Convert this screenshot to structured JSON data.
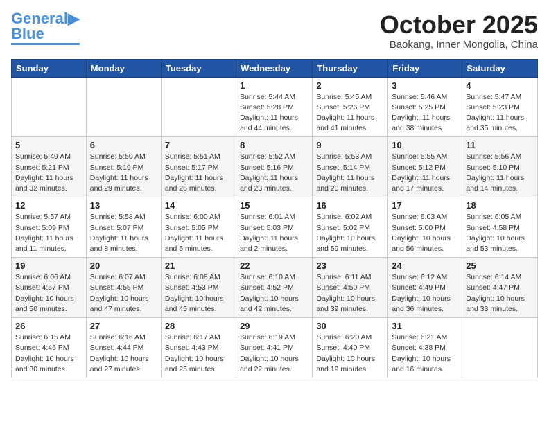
{
  "header": {
    "logo_line1": "General",
    "logo_line2": "Blue",
    "month": "October 2025",
    "location": "Baokang, Inner Mongolia, China"
  },
  "weekdays": [
    "Sunday",
    "Monday",
    "Tuesday",
    "Wednesday",
    "Thursday",
    "Friday",
    "Saturday"
  ],
  "weeks": [
    [
      {
        "day": "",
        "info": ""
      },
      {
        "day": "",
        "info": ""
      },
      {
        "day": "",
        "info": ""
      },
      {
        "day": "1",
        "info": "Sunrise: 5:44 AM\nSunset: 5:28 PM\nDaylight: 11 hours and 44 minutes."
      },
      {
        "day": "2",
        "info": "Sunrise: 5:45 AM\nSunset: 5:26 PM\nDaylight: 11 hours and 41 minutes."
      },
      {
        "day": "3",
        "info": "Sunrise: 5:46 AM\nSunset: 5:25 PM\nDaylight: 11 hours and 38 minutes."
      },
      {
        "day": "4",
        "info": "Sunrise: 5:47 AM\nSunset: 5:23 PM\nDaylight: 11 hours and 35 minutes."
      }
    ],
    [
      {
        "day": "5",
        "info": "Sunrise: 5:49 AM\nSunset: 5:21 PM\nDaylight: 11 hours and 32 minutes."
      },
      {
        "day": "6",
        "info": "Sunrise: 5:50 AM\nSunset: 5:19 PM\nDaylight: 11 hours and 29 minutes."
      },
      {
        "day": "7",
        "info": "Sunrise: 5:51 AM\nSunset: 5:17 PM\nDaylight: 11 hours and 26 minutes."
      },
      {
        "day": "8",
        "info": "Sunrise: 5:52 AM\nSunset: 5:16 PM\nDaylight: 11 hours and 23 minutes."
      },
      {
        "day": "9",
        "info": "Sunrise: 5:53 AM\nSunset: 5:14 PM\nDaylight: 11 hours and 20 minutes."
      },
      {
        "day": "10",
        "info": "Sunrise: 5:55 AM\nSunset: 5:12 PM\nDaylight: 11 hours and 17 minutes."
      },
      {
        "day": "11",
        "info": "Sunrise: 5:56 AM\nSunset: 5:10 PM\nDaylight: 11 hours and 14 minutes."
      }
    ],
    [
      {
        "day": "12",
        "info": "Sunrise: 5:57 AM\nSunset: 5:09 PM\nDaylight: 11 hours and 11 minutes."
      },
      {
        "day": "13",
        "info": "Sunrise: 5:58 AM\nSunset: 5:07 PM\nDaylight: 11 hours and 8 minutes."
      },
      {
        "day": "14",
        "info": "Sunrise: 6:00 AM\nSunset: 5:05 PM\nDaylight: 11 hours and 5 minutes."
      },
      {
        "day": "15",
        "info": "Sunrise: 6:01 AM\nSunset: 5:03 PM\nDaylight: 11 hours and 2 minutes."
      },
      {
        "day": "16",
        "info": "Sunrise: 6:02 AM\nSunset: 5:02 PM\nDaylight: 10 hours and 59 minutes."
      },
      {
        "day": "17",
        "info": "Sunrise: 6:03 AM\nSunset: 5:00 PM\nDaylight: 10 hours and 56 minutes."
      },
      {
        "day": "18",
        "info": "Sunrise: 6:05 AM\nSunset: 4:58 PM\nDaylight: 10 hours and 53 minutes."
      }
    ],
    [
      {
        "day": "19",
        "info": "Sunrise: 6:06 AM\nSunset: 4:57 PM\nDaylight: 10 hours and 50 minutes."
      },
      {
        "day": "20",
        "info": "Sunrise: 6:07 AM\nSunset: 4:55 PM\nDaylight: 10 hours and 47 minutes."
      },
      {
        "day": "21",
        "info": "Sunrise: 6:08 AM\nSunset: 4:53 PM\nDaylight: 10 hours and 45 minutes."
      },
      {
        "day": "22",
        "info": "Sunrise: 6:10 AM\nSunset: 4:52 PM\nDaylight: 10 hours and 42 minutes."
      },
      {
        "day": "23",
        "info": "Sunrise: 6:11 AM\nSunset: 4:50 PM\nDaylight: 10 hours and 39 minutes."
      },
      {
        "day": "24",
        "info": "Sunrise: 6:12 AM\nSunset: 4:49 PM\nDaylight: 10 hours and 36 minutes."
      },
      {
        "day": "25",
        "info": "Sunrise: 6:14 AM\nSunset: 4:47 PM\nDaylight: 10 hours and 33 minutes."
      }
    ],
    [
      {
        "day": "26",
        "info": "Sunrise: 6:15 AM\nSunset: 4:46 PM\nDaylight: 10 hours and 30 minutes."
      },
      {
        "day": "27",
        "info": "Sunrise: 6:16 AM\nSunset: 4:44 PM\nDaylight: 10 hours and 27 minutes."
      },
      {
        "day": "28",
        "info": "Sunrise: 6:17 AM\nSunset: 4:43 PM\nDaylight: 10 hours and 25 minutes."
      },
      {
        "day": "29",
        "info": "Sunrise: 6:19 AM\nSunset: 4:41 PM\nDaylight: 10 hours and 22 minutes."
      },
      {
        "day": "30",
        "info": "Sunrise: 6:20 AM\nSunset: 4:40 PM\nDaylight: 10 hours and 19 minutes."
      },
      {
        "day": "31",
        "info": "Sunrise: 6:21 AM\nSunset: 4:38 PM\nDaylight: 10 hours and 16 minutes."
      },
      {
        "day": "",
        "info": ""
      }
    ]
  ]
}
